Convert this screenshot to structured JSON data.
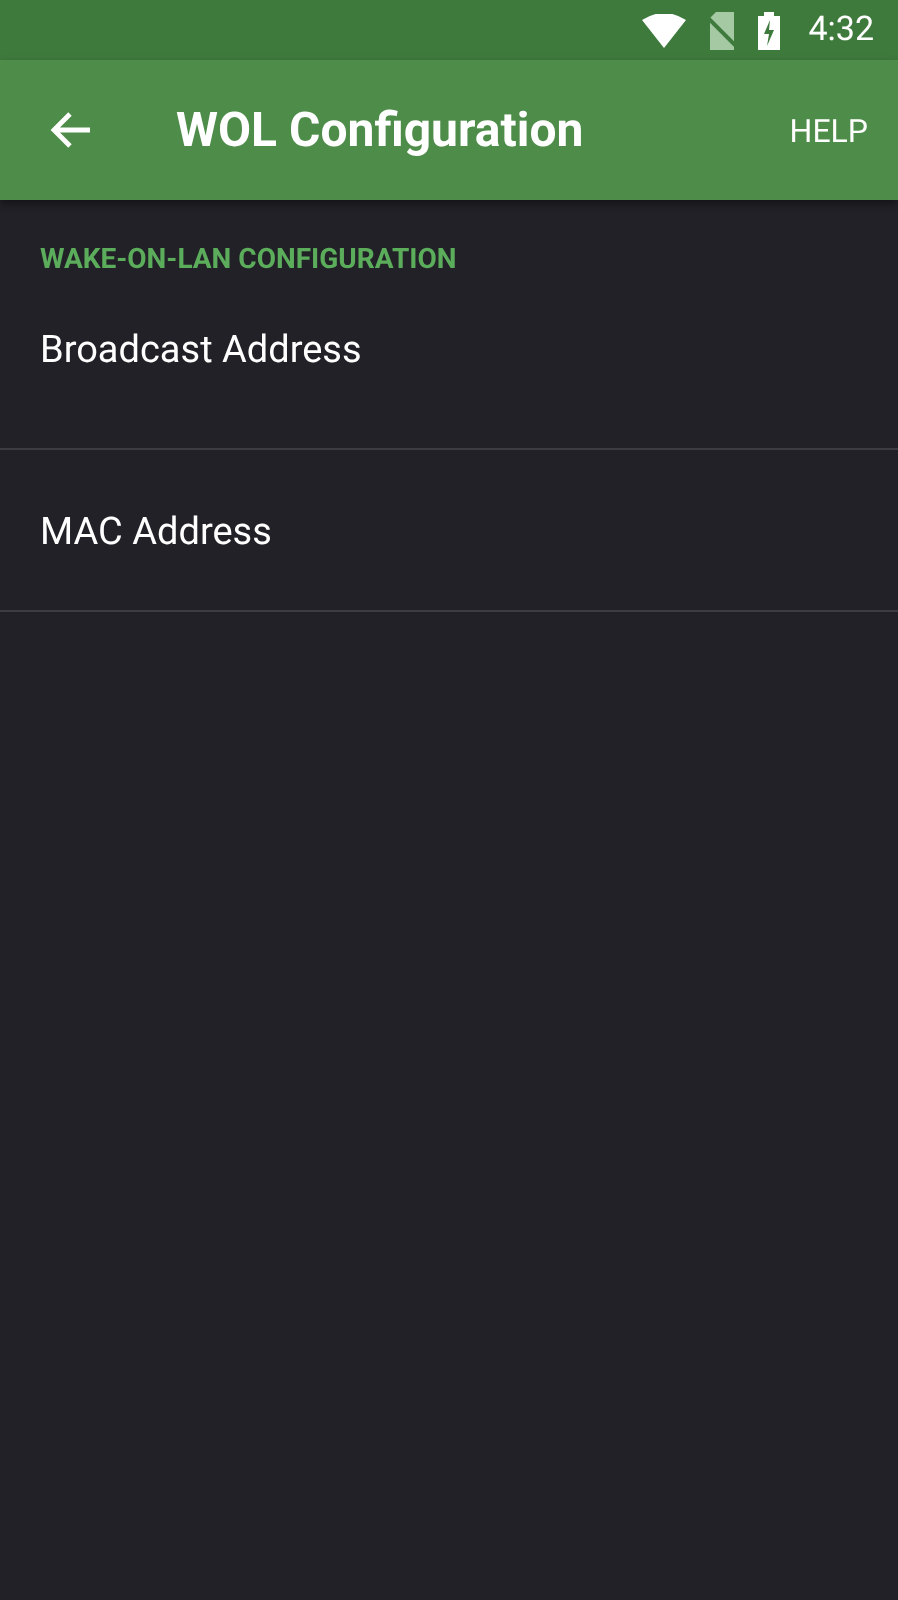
{
  "status_bar": {
    "time": "4:32"
  },
  "app_bar": {
    "title": "WOL Configuration",
    "action": "HELP"
  },
  "section": {
    "header": "WAKE-ON-LAN CONFIGURATION",
    "items": [
      {
        "title": "Broadcast Address"
      },
      {
        "title": "MAC Address"
      }
    ]
  }
}
